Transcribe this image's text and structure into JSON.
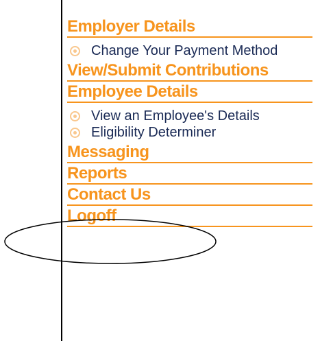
{
  "nav": {
    "employer_details": {
      "label": "Employer Details",
      "items": [
        {
          "label": "Change Your Payment Method"
        }
      ]
    },
    "view_submit_contributions": {
      "label": "View/Submit Contributions"
    },
    "employee_details": {
      "label": "Employee Details",
      "items": [
        {
          "label": "View an Employee's Details"
        },
        {
          "label": "Eligibility Determiner"
        }
      ]
    },
    "messaging": {
      "label": "Messaging"
    },
    "reports": {
      "label": "Reports"
    },
    "contact_us": {
      "label": "Contact Us"
    },
    "logoff": {
      "label": "Logoff"
    }
  },
  "colors": {
    "section_text": "#f7941d",
    "section_rule": "#f7941d",
    "link_text": "#1a2a55",
    "bullet": "#f9c78d",
    "annotation": "#000000"
  },
  "icons": {
    "bullet": "circle-bullet-icon"
  }
}
